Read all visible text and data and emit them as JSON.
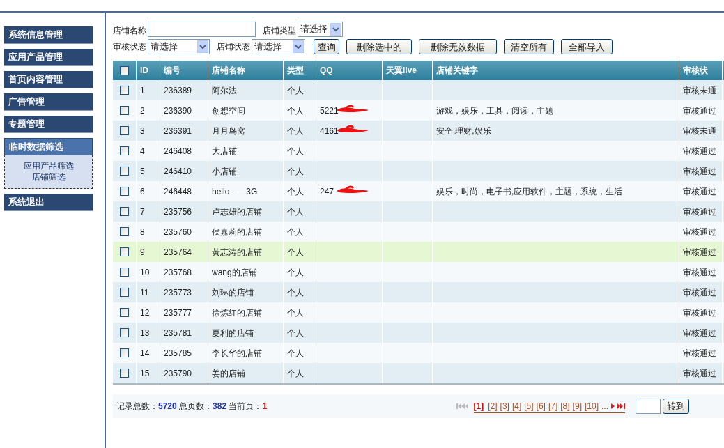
{
  "sidebar": {
    "items": [
      {
        "label": "系统信息管理",
        "expanded": false
      },
      {
        "label": "应用产品管理",
        "expanded": false
      },
      {
        "label": "首页内容管理",
        "expanded": false
      },
      {
        "label": "广告管理",
        "expanded": false
      },
      {
        "label": "专题管理",
        "expanded": false
      },
      {
        "label": "临时数据筛选",
        "expanded": true,
        "children": [
          "应用产品筛选",
          "店铺筛选"
        ]
      },
      {
        "label": "系统退出",
        "expanded": false
      }
    ]
  },
  "filters": {
    "shop_name_label": "店铺名称",
    "shop_type_label": "店铺类型",
    "shop_type_value": "请选择",
    "review_label": "审核状态",
    "review_value": "请选择",
    "shop_status_label": "店铺状态",
    "shop_status_value": "请选择"
  },
  "buttons": [
    "查询",
    "删除选中的",
    "删除无效数据",
    "清空所有",
    "全部导入"
  ],
  "table": {
    "header_checked": false,
    "columns": [
      "ID",
      "编号",
      "店铺名称",
      "类型",
      "QQ",
      "天翼live",
      "店铺关键字",
      "审核状"
    ],
    "rows": [
      {
        "checked": false,
        "highlighted": false,
        "id": "1",
        "code": "236389",
        "name": "阿尔法",
        "type": "个人",
        "status": "审核未通"
      },
      {
        "checked": false,
        "highlighted": false,
        "id": "2",
        "code": "236390",
        "name": "创想空间",
        "type": "个人",
        "qq": "5221",
        "qq_redacted": true,
        "keywords": "游戏，娱乐，工具，阅读，主题",
        "status": "审核通过"
      },
      {
        "checked": false,
        "highlighted": false,
        "id": "3",
        "code": "236391",
        "name": "月月鸟窝",
        "type": "个人",
        "qq": "4161",
        "qq_redacted": true,
        "keywords": "安全,理财,娱乐",
        "status": "审核未通"
      },
      {
        "checked": false,
        "highlighted": false,
        "id": "4",
        "code": "246408",
        "name": "大店铺",
        "type": "个人",
        "status": "审核通过"
      },
      {
        "checked": false,
        "highlighted": false,
        "id": "5",
        "code": "246410",
        "name": "小店铺",
        "type": "个人",
        "status": "审核通过"
      },
      {
        "checked": false,
        "highlighted": false,
        "id": "6",
        "code": "246448",
        "name": "hello——3G",
        "type": "个人",
        "qq": "247",
        "qq_redacted": true,
        "keywords": "娱乐，时尚，电子书,应用软件，主题，系统，生活",
        "status": "审核通过"
      },
      {
        "checked": false,
        "highlighted": false,
        "id": "7",
        "code": "235756",
        "name": "卢志雄的店铺",
        "type": "个人",
        "status": "审核通过"
      },
      {
        "checked": false,
        "highlighted": false,
        "id": "8",
        "code": "235760",
        "name": "侯嘉莉的店铺",
        "type": "个人",
        "status": "审核通过"
      },
      {
        "checked": false,
        "highlighted": true,
        "id": "9",
        "code": "235764",
        "name": "黃志涛的店铺",
        "type": "个人",
        "status": "审核通过"
      },
      {
        "checked": false,
        "highlighted": false,
        "id": "10",
        "code": "235768",
        "name": "wang的店铺",
        "type": "个人",
        "status": "审核通过"
      },
      {
        "checked": false,
        "highlighted": false,
        "id": "11",
        "code": "235773",
        "name": "刘琳的店铺",
        "type": "个人",
        "status": "审核通过"
      },
      {
        "checked": false,
        "highlighted": false,
        "id": "12",
        "code": "235777",
        "name": "徐炼红的店铺",
        "type": "个人",
        "status": "审核通过"
      },
      {
        "checked": false,
        "highlighted": false,
        "id": "13",
        "code": "235781",
        "name": "夏利的店铺",
        "type": "个人",
        "status": "审核通过"
      },
      {
        "checked": false,
        "highlighted": false,
        "id": "14",
        "code": "235785",
        "name": "李长华的店铺",
        "type": "个人",
        "status": "审核通过"
      },
      {
        "checked": false,
        "highlighted": false,
        "id": "15",
        "code": "235790",
        "name": "姜的店铺",
        "type": "个人",
        "status": "审核通过"
      }
    ]
  },
  "footer": {
    "total_label": "记录总数：",
    "total": "5720",
    "pages_label": "总页数：",
    "pages": "382",
    "current_label": "当前页：",
    "current": "1",
    "page_links": [
      {
        "label": "[1]",
        "selected": true
      },
      {
        "label": "[2]",
        "selected": false
      },
      {
        "label": "[3]",
        "selected": false
      },
      {
        "label": "[4]",
        "selected": false
      },
      {
        "label": "[5]",
        "selected": false
      },
      {
        "label": "[6]",
        "selected": false
      },
      {
        "label": "[7]",
        "selected": false
      },
      {
        "label": "[8]",
        "selected": false
      },
      {
        "label": "[9]",
        "selected": false
      },
      {
        "label": "[10]",
        "selected": false
      }
    ],
    "ellipsis": "...",
    "goto_button": "转到"
  }
}
